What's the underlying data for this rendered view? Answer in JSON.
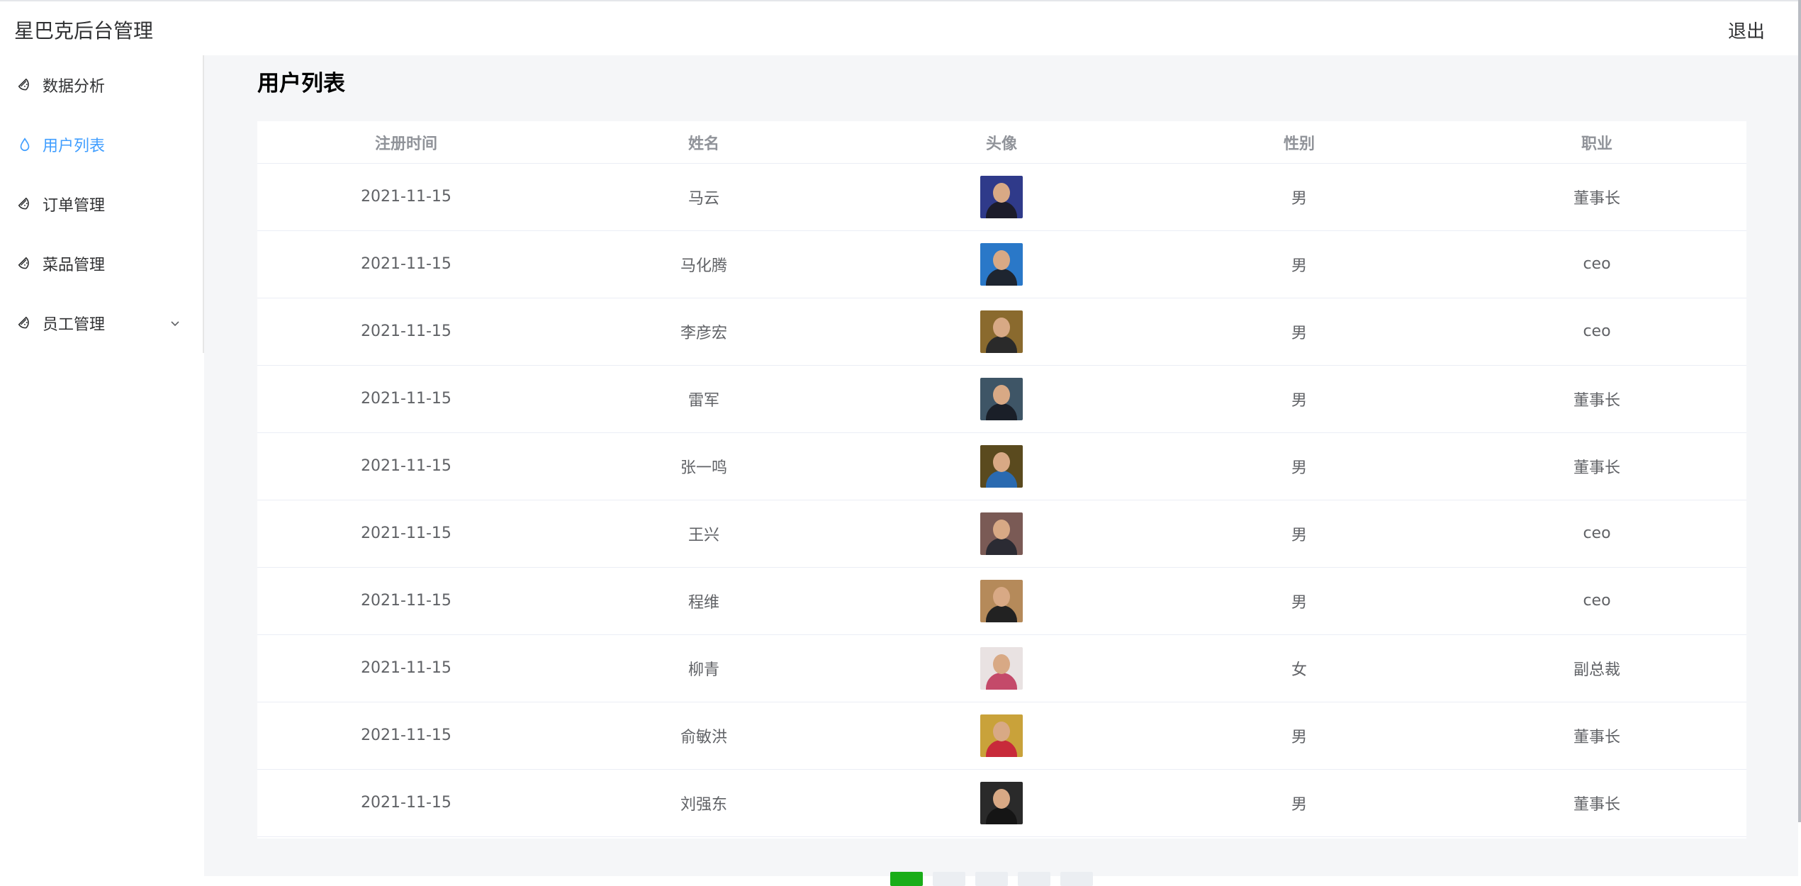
{
  "header": {
    "brand": "星巴克后台管理",
    "logout_label": "退出"
  },
  "sidebar": {
    "items": [
      {
        "label": "数据分析",
        "icon": "watermelon-icon",
        "active": false
      },
      {
        "label": "用户列表",
        "icon": "drop-icon",
        "active": true
      },
      {
        "label": "订单管理",
        "icon": "watermelon-icon",
        "active": false
      },
      {
        "label": "菜品管理",
        "icon": "watermelon-icon",
        "active": false
      },
      {
        "label": "员工管理",
        "icon": "watermelon-icon",
        "active": false,
        "has_submenu": true
      }
    ]
  },
  "main": {
    "title": "用户列表",
    "table": {
      "columns": [
        "注册时间",
        "姓名",
        "头像",
        "性别",
        "职业"
      ],
      "rows": [
        {
          "date": "2021-11-15",
          "name": "马云",
          "gender": "男",
          "job": "董事长",
          "avatar_bg": "#2f3a8a",
          "avatar_cloth": "#1c1c2a"
        },
        {
          "date": "2021-11-15",
          "name": "马化腾",
          "gender": "男",
          "job": "ceo",
          "avatar_bg": "#2a78c8",
          "avatar_cloth": "#1e2530"
        },
        {
          "date": "2021-11-15",
          "name": "李彦宏",
          "gender": "男",
          "job": "ceo",
          "avatar_bg": "#8a6a2e",
          "avatar_cloth": "#2a2a2a"
        },
        {
          "date": "2021-11-15",
          "name": "雷军",
          "gender": "男",
          "job": "董事长",
          "avatar_bg": "#3e5566",
          "avatar_cloth": "#1a1f28"
        },
        {
          "date": "2021-11-15",
          "name": "张一鸣",
          "gender": "男",
          "job": "董事长",
          "avatar_bg": "#5a4a1e",
          "avatar_cloth": "#2a6ab0"
        },
        {
          "date": "2021-11-15",
          "name": "王兴",
          "gender": "男",
          "job": "ceo",
          "avatar_bg": "#7a5a55",
          "avatar_cloth": "#2b2b33"
        },
        {
          "date": "2021-11-15",
          "name": "程维",
          "gender": "男",
          "job": "ceo",
          "avatar_bg": "#b58a5a",
          "avatar_cloth": "#222"
        },
        {
          "date": "2021-11-15",
          "name": "柳青",
          "gender": "女",
          "job": "副总裁",
          "avatar_bg": "#e9e2e2",
          "avatar_cloth": "#c44a6a"
        },
        {
          "date": "2021-11-15",
          "name": "俞敏洪",
          "gender": "男",
          "job": "董事长",
          "avatar_bg": "#c9a23a",
          "avatar_cloth": "#c82a3a"
        },
        {
          "date": "2021-11-15",
          "name": "刘强东",
          "gender": "男",
          "job": "董事长",
          "avatar_bg": "#2a2a2a",
          "avatar_cloth": "#151515"
        }
      ]
    }
  },
  "pagination": {
    "pages": 5,
    "current": 1
  }
}
